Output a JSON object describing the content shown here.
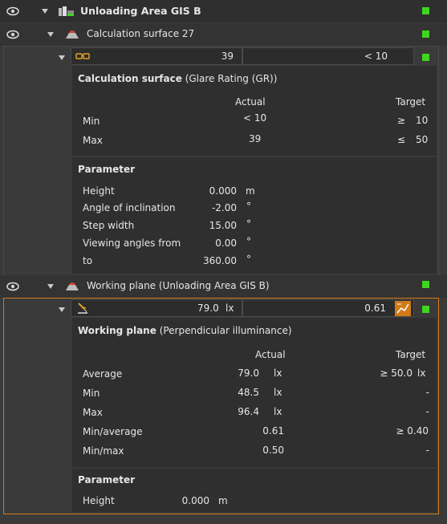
{
  "tree": {
    "root": {
      "label": "Unloading Area GIS B",
      "icon": "building-icon"
    },
    "calc": {
      "label": "Calculation surface 27",
      "icon": "calculation-surface-icon",
      "summary": {
        "actual": "39",
        "target": "< 10"
      },
      "results": {
        "title": "Calculation surface",
        "subtitle": "(Glare Rating (GR))",
        "col_actual": "Actual",
        "col_target": "Target",
        "rows": [
          {
            "label": "Min",
            "actual": "< 10",
            "target_sym": "≥",
            "target": "10"
          },
          {
            "label": "Max",
            "actual": "39",
            "target_sym": "≤",
            "target": "50"
          }
        ]
      },
      "parameter": {
        "title": "Parameter",
        "rows": [
          {
            "label": "Height",
            "value": "0.000",
            "unit": "m"
          },
          {
            "label": "Angle of inclination",
            "value": "-2.00",
            "unit": "°"
          },
          {
            "label": "Step width",
            "value": "15.00",
            "unit": "°"
          },
          {
            "label": "Viewing angles from",
            "value": "0.00",
            "unit": "°"
          },
          {
            "label": "to",
            "value": "360.00",
            "unit": "°"
          }
        ]
      }
    },
    "work": {
      "label": "Working plane (Unloading Area GIS B)",
      "icon": "working-plane-icon",
      "summary": {
        "actual": "79.0",
        "unit": "lx",
        "target": "0.61"
      },
      "results": {
        "title": "Working plane",
        "subtitle": "(Perpendicular illuminance)",
        "col_actual": "Actual",
        "col_target": "Target",
        "rows": [
          {
            "label": "Average",
            "actual": "79.0",
            "actual_unit": "lx",
            "target": "≥ 50.0",
            "target_unit": "lx"
          },
          {
            "label": "Min",
            "actual": "48.5",
            "actual_unit": "lx",
            "target": "-",
            "target_unit": ""
          },
          {
            "label": "Max",
            "actual": "96.4",
            "actual_unit": "lx",
            "target": "-",
            "target_unit": ""
          },
          {
            "label": "Min/average",
            "actual": "0.61",
            "actual_unit": "",
            "target": "≥ 0.40",
            "target_unit": ""
          },
          {
            "label": "Min/max",
            "actual": "0.50",
            "actual_unit": "",
            "target": "-",
            "target_unit": ""
          }
        ]
      },
      "parameter": {
        "title": "Parameter",
        "rows": [
          {
            "label": "Height",
            "value": "0.000",
            "unit": "m"
          }
        ]
      }
    }
  },
  "colors": {
    "status_ok": "#3ed61e",
    "selection_border": "#d07a1a",
    "background": "#3a3a3a"
  }
}
